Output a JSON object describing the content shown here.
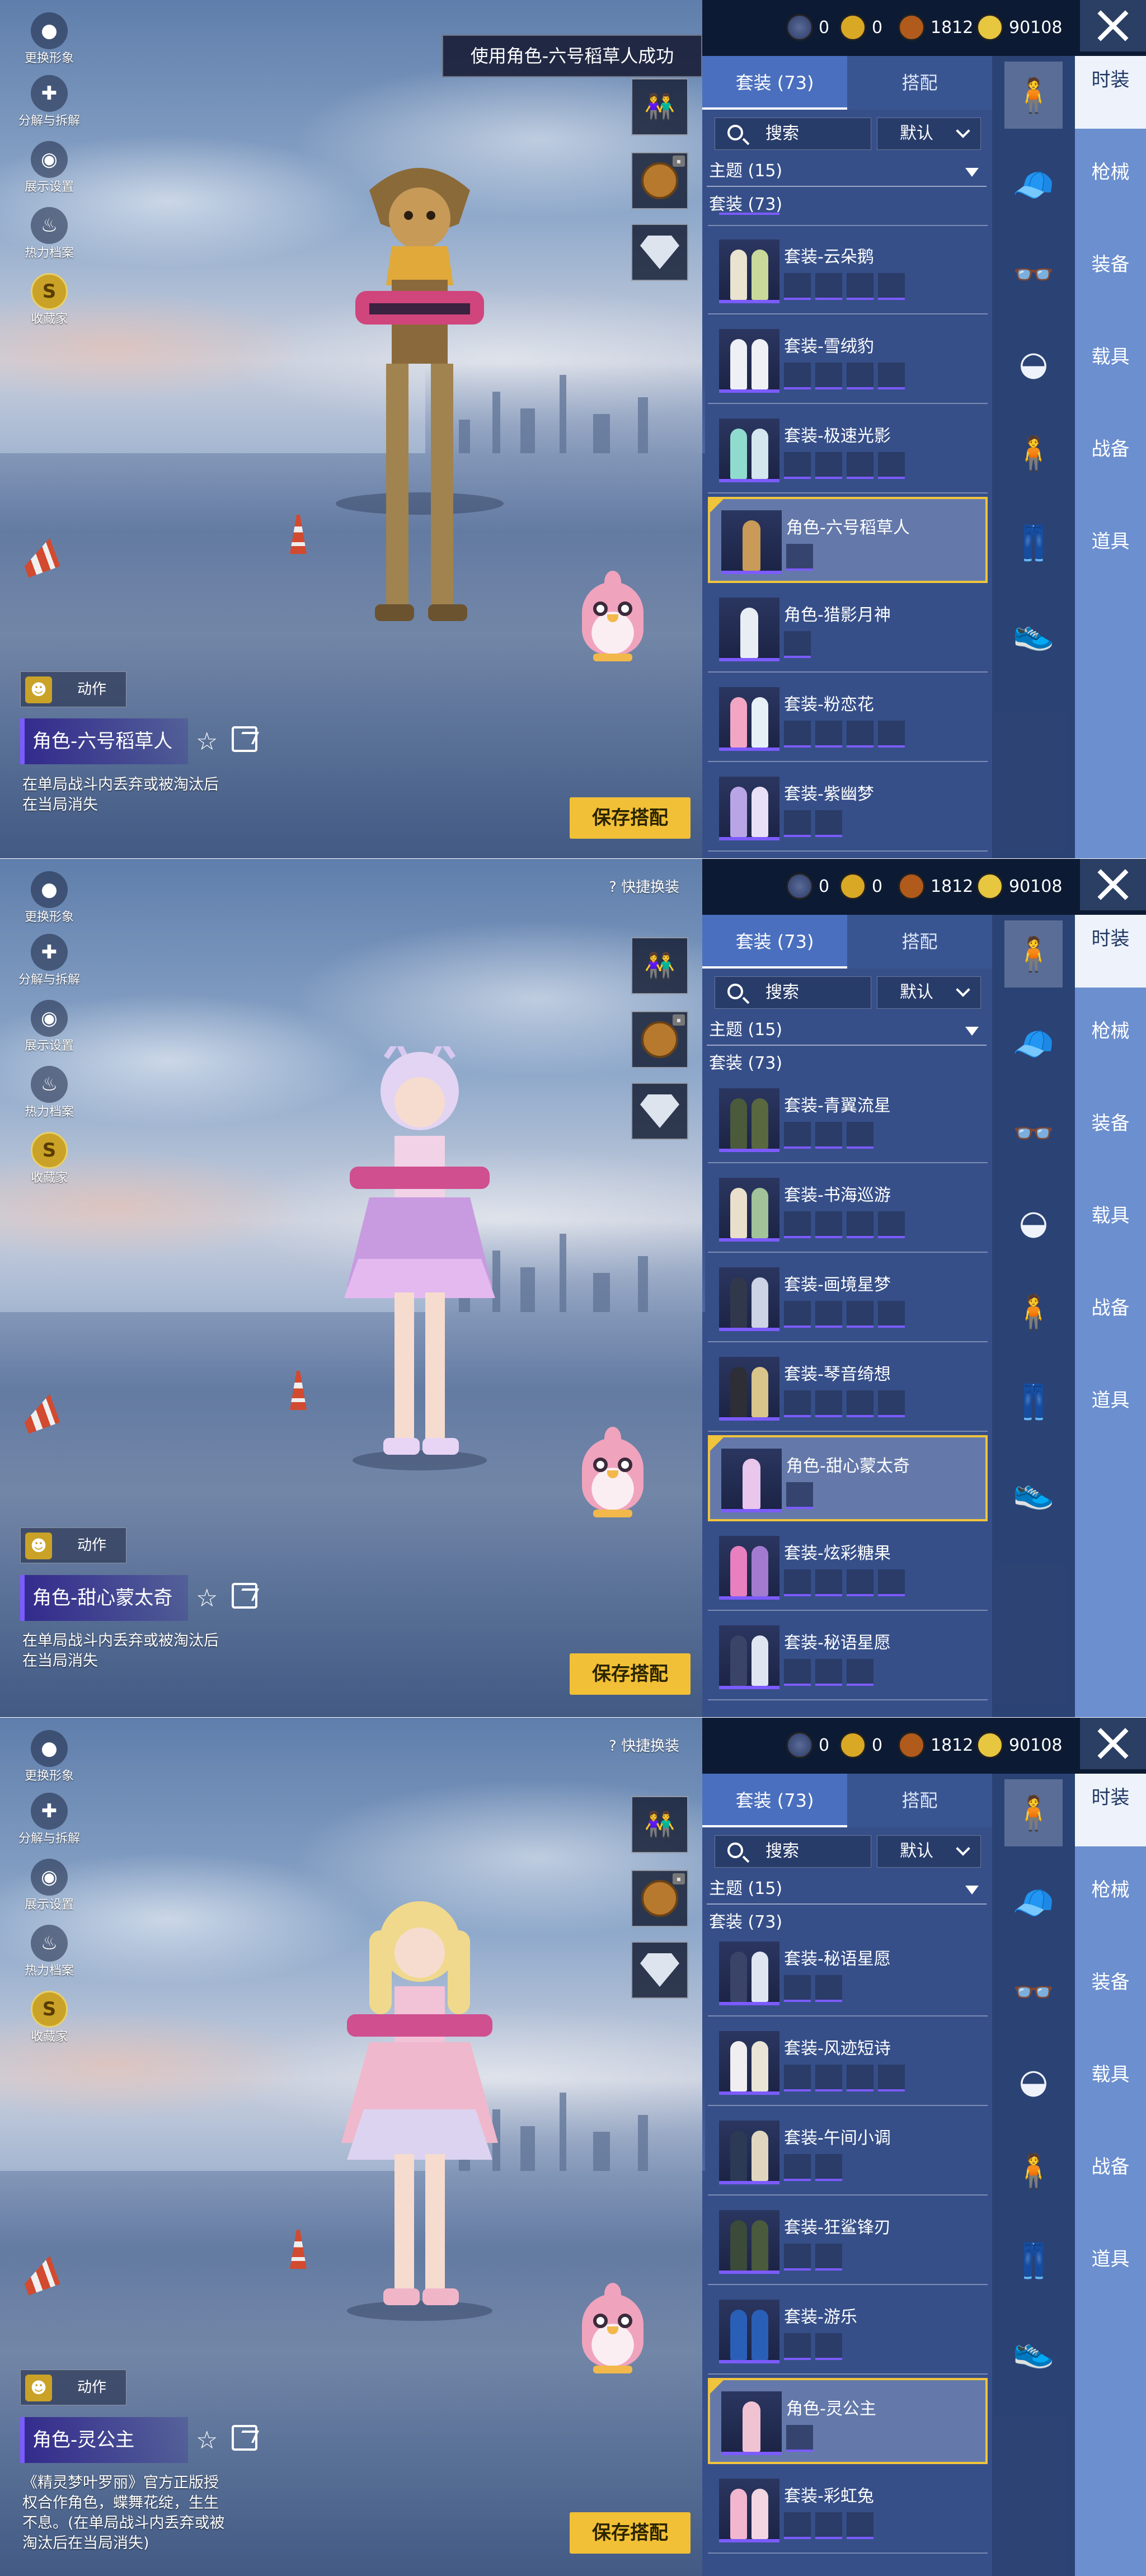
{
  "currency": {
    "globe": "0",
    "uc": "0",
    "bp": "1812",
    "ag": "90108"
  },
  "left_menu": [
    "更换形象",
    "分解与拆解",
    "展示设置",
    "热力档案",
    "收藏家"
  ],
  "tabs": {
    "suits": "套装 (73)",
    "match": "搭配"
  },
  "search": "搜索",
  "sort": "默认",
  "topic": "主题 (15)",
  "suit_count": "套装 (73)",
  "quick_swap": "快捷换装",
  "action": "动作",
  "save": "保存搭配",
  "categories": [
    "时装",
    "枪械",
    "装备",
    "载具",
    "战备",
    "道具"
  ],
  "panel1": {
    "toast": "使用角色-六号稻草人成功",
    "char_name": "角色-六号稻草人",
    "desc": [
      "在单局战斗内丢弃或被淘汰后",
      "在当局消失"
    ],
    "items": [
      "套装-云朵鹅",
      "套装-雪绒豹",
      "套装-极速光影",
      "角色-六号稻草人",
      "角色-猎影月神",
      "套装-粉恋花",
      "套装-紫幽梦"
    ]
  },
  "panel2": {
    "char_name": "角色-甜心蒙太奇",
    "desc": [
      "在单局战斗内丢弃或被淘汰后",
      "在当局消失"
    ],
    "items": [
      "套装-青翼流星",
      "套装-书海巡游",
      "套装-画境星梦",
      "套装-琴音绮想",
      "角色-甜心蒙太奇",
      "套装-炫彩糖果",
      "套装-秘语星愿"
    ]
  },
  "panel3": {
    "char_name": "角色-灵公主",
    "desc": [
      "《精灵梦叶罗丽》官方正版授",
      "权合作角色，蝶舞花绽，生生",
      "不息。(在单局战斗内丢弃或被",
      "淘汰后在当局消失)"
    ],
    "items": [
      "套装-秘语星愿",
      "套装-风迹短诗",
      "套装-午间小调",
      "套装-狂鲨锋刃",
      "套装-游乐",
      "角色-灵公主",
      "套装-彩虹兔"
    ]
  }
}
